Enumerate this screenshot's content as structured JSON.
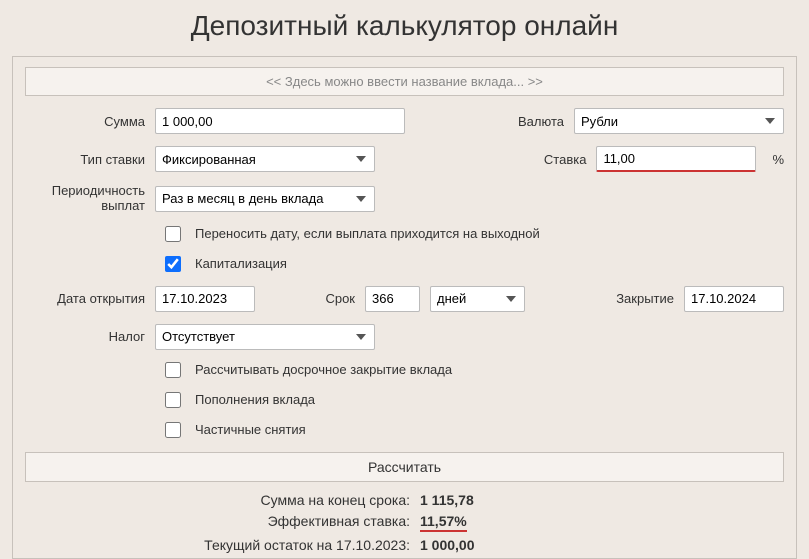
{
  "title": "Депозитный калькулятор онлайн",
  "deposit_name_placeholder": "<< Здесь можно ввести название вклада... >>",
  "labels": {
    "amount": "Сумма",
    "currency": "Валюта",
    "rate_type": "Тип ставки",
    "rate": "Ставка",
    "payout_period": "Периодичность выплат",
    "open_date": "Дата открытия",
    "term": "Срок",
    "close_date": "Закрытие",
    "tax": "Налог",
    "percent_sign": "%"
  },
  "values": {
    "amount": "1 000,00",
    "currency": "Рубли",
    "rate_type": "Фиксированная",
    "rate": "11,00",
    "payout_period": "Раз в месяц в день вклада",
    "open_date": "17.10.2023",
    "term": "366",
    "term_unit": "дней",
    "close_date": "17.10.2024",
    "tax": "Отсутствует"
  },
  "checkboxes": {
    "weekend_shift": "Переносить дату, если выплата приходится на выходной",
    "capitalization": "Капитализация",
    "early_close": "Рассчитывать досрочное закрытие вклада",
    "topups": "Пополнения вклада",
    "withdrawals": "Частичные снятия"
  },
  "calc_button": "Рассчитать",
  "results": {
    "end_sum_label": "Сумма на конец срока:",
    "end_sum_value": "1 115,78",
    "eff_rate_label": "Эффективная ставка:",
    "eff_rate_value": "11,57%",
    "balance_label": "Текущий остаток на 17.10.2023:",
    "balance_value": "1 000,00"
  }
}
